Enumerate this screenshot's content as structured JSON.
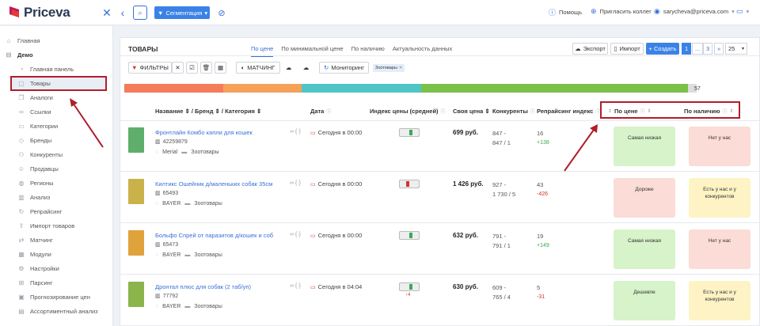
{
  "app": {
    "name": "Priceva"
  },
  "topbar": {
    "segment_label": "Сегментация",
    "help": "Помощь",
    "invite": "Пригласить коллег",
    "email": "sarycheva@priceva.com"
  },
  "sidebar": {
    "items": [
      {
        "label": "Главная",
        "icon": "home-icon",
        "level": 0
      },
      {
        "label": "Демо",
        "icon": "minus-box-icon",
        "level": 0,
        "bold": true
      },
      {
        "label": "Главная панель",
        "icon": "dashboard-icon",
        "level": 1
      },
      {
        "label": "Товары",
        "icon": "box-icon",
        "level": 1,
        "active": true
      },
      {
        "label": "Аналоги",
        "icon": "copy-icon",
        "level": 1
      },
      {
        "label": "Ссылки",
        "icon": "link-icon",
        "level": 1
      },
      {
        "label": "Категории",
        "icon": "folder-icon",
        "level": 1
      },
      {
        "label": "Бренды",
        "icon": "tag-icon",
        "level": 1
      },
      {
        "label": "Конкуренты",
        "icon": "users-icon",
        "level": 1
      },
      {
        "label": "Продавцы",
        "icon": "user-icon",
        "level": 1
      },
      {
        "label": "Регионы",
        "icon": "globe-icon",
        "level": 1
      },
      {
        "label": "Анализ",
        "icon": "chart-icon",
        "level": 1
      },
      {
        "label": "Репрайсинг",
        "icon": "refresh-icon",
        "level": 1
      },
      {
        "label": "Импорт товаров",
        "icon": "upload-icon",
        "level": 1
      },
      {
        "label": "Матчинг",
        "icon": "match-icon",
        "level": 1
      },
      {
        "label": "Модули",
        "icon": "module-icon",
        "level": 1
      },
      {
        "label": "Настройки",
        "icon": "gear-icon",
        "level": 1
      },
      {
        "label": "Парсинг",
        "icon": "parse-icon",
        "level": 1
      },
      {
        "label": "Прогнозирование цен",
        "icon": "forecast-icon",
        "level": 1
      },
      {
        "label": "Ассортиментный анализ",
        "icon": "assort-icon",
        "level": 1
      }
    ]
  },
  "main": {
    "title": "ТОВАРЫ",
    "tabs": [
      {
        "label": "По цене",
        "active": true
      },
      {
        "label": "По минимальной цене"
      },
      {
        "label": "По наличию"
      },
      {
        "label": "Актуальность данных"
      }
    ],
    "export_label": "Экспорт",
    "import_label": "Импорт",
    "create_label": "+ Создать",
    "pagination": [
      "1",
      "...",
      "3",
      "»"
    ],
    "per_page": "25",
    "filters_label": "ФИЛЬТРЫ",
    "matching_label": "МАТЧИНГ",
    "monitoring_label": "Мониторинг",
    "filter_tag": "Зоотовары",
    "progress_count": "57",
    "progress_segments": [
      {
        "fraction": 0.175,
        "color": "#f47c5a"
      },
      {
        "fraction": 0.14,
        "color": "#f5a15a"
      },
      {
        "fraction": 0.212,
        "color": "#4fc5c8"
      },
      {
        "fraction": 0.473,
        "color": "#79c14a"
      }
    ],
    "columns": {
      "name": "Название ⇕ / Бренд ⇕ / Категория ⇕",
      "date": "Дата",
      "index": "Индекс цены (средней)",
      "own_price": "Своя цена ⇕",
      "competitors": "Конкуренты",
      "repricing": "Репрайсинг индекс",
      "by_price": "По цене",
      "by_availability": "По наличию"
    },
    "rows": [
      {
        "name": "Фронтлайн Комбо капли для кошек",
        "code": "42259879",
        "brand": "Merial",
        "category": "Зоотовары",
        "date": "Сегодня в 00:00",
        "price": "699 руб.",
        "competitors_a": "847 -",
        "competitors_b": "847 / 1",
        "rep_a": "16",
        "rep_b": "+138",
        "rep_b_color": "#3aa85a",
        "index_pos": 0.55,
        "index_color": "#3aa85a",
        "index_sub": "",
        "by_price": "Самая низкая",
        "by_price_color": "#d6f3c9",
        "by_avail": "Нет у нас",
        "by_avail_color": "#fcdcd6",
        "img_color": "#5fae6b"
      },
      {
        "name": "Килтикс Ошейник д/маленьких собак 35см",
        "code": "65493",
        "brand": "BAYER",
        "category": "Зоотовары",
        "date": "Сегодня в 00:00",
        "price": "1 426 руб.",
        "competitors_a": "927 -",
        "competitors_b": "1 730 / 5",
        "rep_a": "43",
        "rep_b": "-426",
        "rep_b_color": "#d0342c",
        "index_pos": 0.35,
        "index_color": "#d0342c",
        "index_sub": "",
        "by_price": "Дороже",
        "by_price_color": "#fcdcd6",
        "by_avail": "Есть у нас и у конкурентов",
        "by_avail_color": "#fdf3c4",
        "img_color": "#c9b24a"
      },
      {
        "name": "Больфо Спрей от паразитов д/кошек и соб",
        "code": "65473",
        "brand": "BAYER",
        "category": "Зоотовары",
        "date": "Сегодня в 00:00",
        "price": "632 руб.",
        "competitors_a": "791 -",
        "competitors_b": "791 / 1",
        "rep_a": "19",
        "rep_b": "+149",
        "rep_b_color": "#3aa85a",
        "index_pos": 0.55,
        "index_color": "#3aa85a",
        "index_sub": "",
        "by_price": "Самая низкая",
        "by_price_color": "#d6f3c9",
        "by_avail": "Нет у нас",
        "by_avail_color": "#fcdcd6",
        "img_color": "#e0a23a"
      },
      {
        "name": "Дронтал плюс для собак (2 таб/уп)",
        "code": "77792",
        "brand": "BAYER",
        "category": "Зоотовары",
        "date": "Сегодня в 04:04",
        "price": "630 руб.",
        "competitors_a": "609 -",
        "competitors_b": "765 / 4",
        "rep_a": "5",
        "rep_b": "-31",
        "rep_b_color": "#d0342c",
        "index_pos": 0.55,
        "index_color": "#3aa85a",
        "index_sub": "↑4",
        "by_price": "Дешевле",
        "by_price_color": "#d6f3c9",
        "by_avail": "Есть у нас и у конкурентов",
        "by_avail_color": "#fdf3c4",
        "img_color": "#8bb44a"
      }
    ]
  }
}
